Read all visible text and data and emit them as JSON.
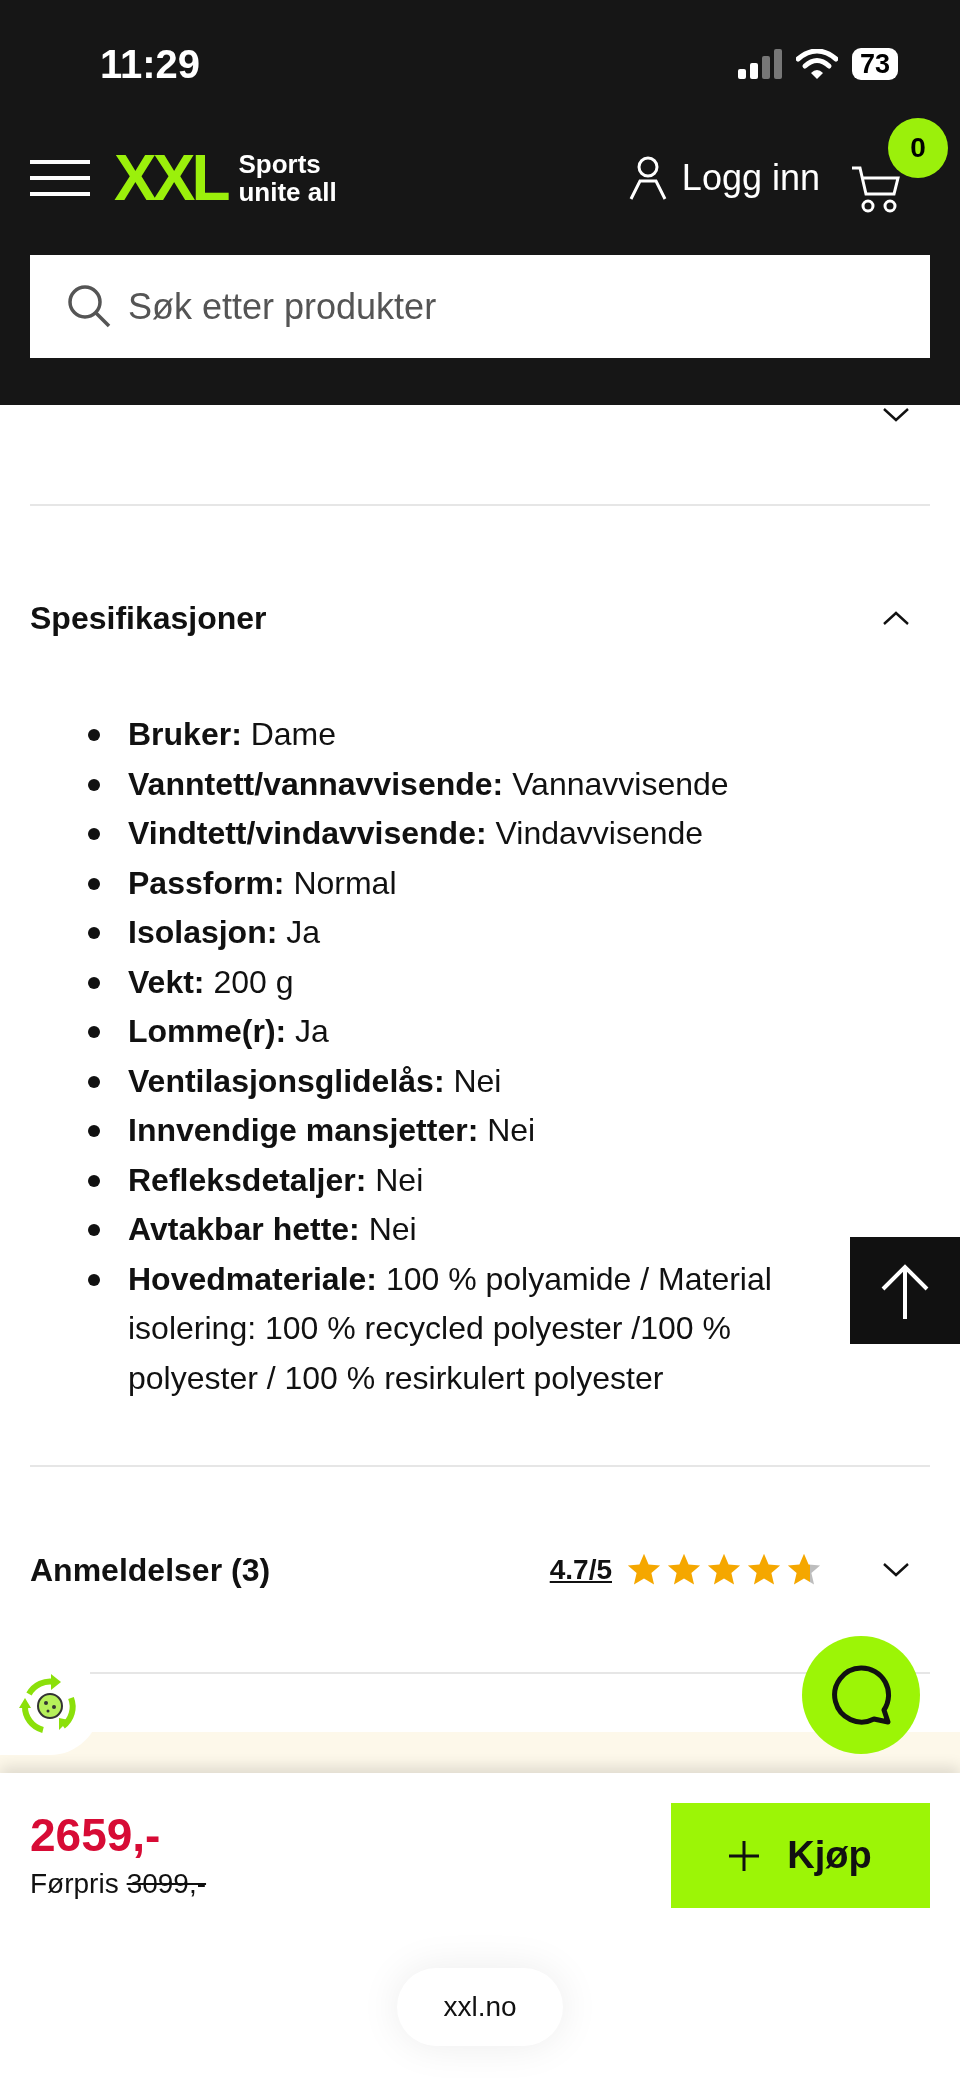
{
  "status_bar": {
    "time": "11:29",
    "battery": "73"
  },
  "header": {
    "logo": "XXL",
    "tagline_1": "Sports",
    "tagline_2": "unite all",
    "login": "Logg inn",
    "cart_count": "0"
  },
  "search": {
    "placeholder": "Søk etter produkter"
  },
  "sections": [
    {
      "expanded": false
    },
    {
      "title": "Spesifikasjoner",
      "expanded": true,
      "specs": [
        {
          "label": "Bruker:",
          "value": "Dame"
        },
        {
          "label": "Vanntett/vannavvisende:",
          "value": "Vannavvisende"
        },
        {
          "label": "Vindtett/vindavvisende:",
          "value": "Vindavvisende"
        },
        {
          "label": "Passform:",
          "value": "Normal"
        },
        {
          "label": "Isolasjon:",
          "value": "Ja"
        },
        {
          "label": "Vekt:",
          "value": "200 g"
        },
        {
          "label": "Lomme(r):",
          "value": "Ja"
        },
        {
          "label": "Ventilasjonsglidelås:",
          "value": "Nei"
        },
        {
          "label": "Innvendige mansjetter:",
          "value": "Nei"
        },
        {
          "label": "Refleksdetaljer:",
          "value": "Nei"
        },
        {
          "label": "Avtakbar hette:",
          "value": "Nei"
        },
        {
          "label": "Hovedmateriale:",
          "value": "100 % polyamide / Material isolering: 100 % recycled polyester /100 % polyester / 100 % resirkulert polyester"
        }
      ]
    },
    {
      "title": "Anmeldelser (3)",
      "expanded": false,
      "rating": "4.7/5",
      "stars": 4.7
    }
  ],
  "buy_bar": {
    "price": "2659,-",
    "previous_label": "Førpris",
    "previous_price": "3099,-",
    "buy": "Kjøp"
  },
  "browser": {
    "url": "xxl.no"
  }
}
